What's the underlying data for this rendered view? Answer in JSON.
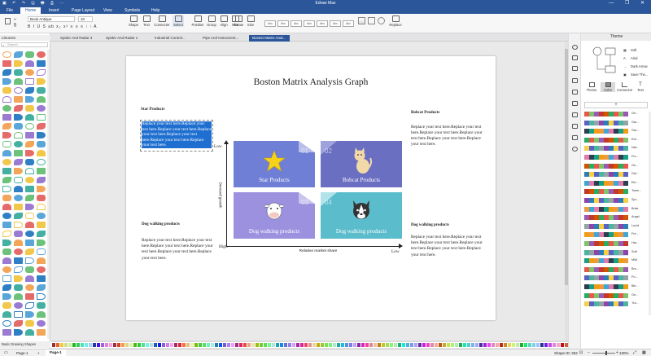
{
  "app": {
    "title": "Edraw Max",
    "quick_tools": "▣ ↶ ↷ 🖫 🖶 ⎙ ⋯",
    "window_controls": [
      "—",
      "❐",
      "✕"
    ]
  },
  "menu": {
    "items": [
      "File",
      "Home",
      "Insert",
      "Page Layout",
      "View",
      "Symbols",
      "Help"
    ],
    "active": "Home"
  },
  "ribbon": {
    "font_name": "Book Antique",
    "font_size": "10",
    "format_glyphs": "B I U S ab x₂ x² ≡ ≡ ≡ ⁝ ⁝ A",
    "buttons": [
      "Shape",
      "Text",
      "Connector",
      "Select",
      "Position",
      "Group",
      "Align",
      "Size",
      "Rotate",
      "Size",
      "Replace"
    ],
    "style_boxes": [
      "Abc",
      "Abc",
      "Abc",
      "Abc",
      "Abc",
      "Abc",
      "Abc"
    ]
  },
  "doc_tabs": [
    "Spider And Radar 3",
    "Spider And Radar 1",
    "Industrial Control...",
    "Pipe And Instrument...",
    "Boston Matrix Anal..."
  ],
  "doc_tab_active": "Boston Matrix Anal...",
  "library": {
    "header": "Libraries",
    "search_placeholder": "Search",
    "footer": "Basic Drawing Shapes"
  },
  "page": {
    "title": "Boston Matrix Analysis Graph",
    "star_heading": "Star Products",
    "star_text": "Replace your text here.Replace your text here.Replace your text here.Replace your text here.Replace your text here.Replace your text here.Replace your text here.",
    "bobcat_heading": "Bobcat Products",
    "bobcat_text": "Replace your text here.Replace your text here.Replace your text here.Replace your text here.Replace your text here.Replace your text here.",
    "dog_left_heading": "Dog walking products",
    "dog_left_text": "Replace your text here.Replace your text here.Replace your text here.Replace your text here.Replace your text here.Replace your text here.",
    "dog_right_heading": "Dog walking products",
    "dog_right_text": "Replace your text here.Replace your text here.Replace your text here.Replace your text here.Replace your text here.Replace your text here.",
    "axis_low_top": "Low",
    "axis_high": "High",
    "axis_low_right": "Low",
    "y_axis_label": "Demand growth",
    "x_axis_label": "Relative market share",
    "quadrants": [
      {
        "label": "Star Products",
        "num": "01",
        "color": "#6f7fd6"
      },
      {
        "label": "Bobcat Products",
        "num": "02",
        "color": "#6a6fc1"
      },
      {
        "label": "Dog walking products",
        "num": "03",
        "color": "#9b91de"
      },
      {
        "label": "Dog walking products",
        "num": "04",
        "color": "#5bbccc"
      }
    ]
  },
  "theme_panel": {
    "title": "Theme",
    "options": [
      "Soft",
      "Arial",
      "Dark Arrow",
      "Save The..."
    ],
    "tabs": [
      "Theme",
      "Color",
      "Connector",
      "Text"
    ],
    "tab_selected": "Color",
    "add": "+",
    "rows": [
      "Ge...",
      "Gar...",
      "Gar...",
      "Edi...",
      "Nat...",
      "Fre...",
      "Ge...",
      "Gal...",
      "Ele...",
      "Twee...",
      "Spr...",
      "Brisk",
      "Angel",
      "Lucid",
      "Fre...",
      "Har...",
      "Soft",
      "Mild",
      "Bro...",
      "Po...",
      "Ble...",
      "Ge...",
      "Tra..."
    ],
    "row_selected": "Soft"
  },
  "status": {
    "page_selector": "Page-1",
    "page_tab": "Page-1",
    "add_page": "+",
    "shape_id": "Shape ID: 252",
    "zoom": "130%"
  },
  "colors": {
    "brand": "#2b579a",
    "selection": "#1f6fd0",
    "axis": "#222222"
  }
}
